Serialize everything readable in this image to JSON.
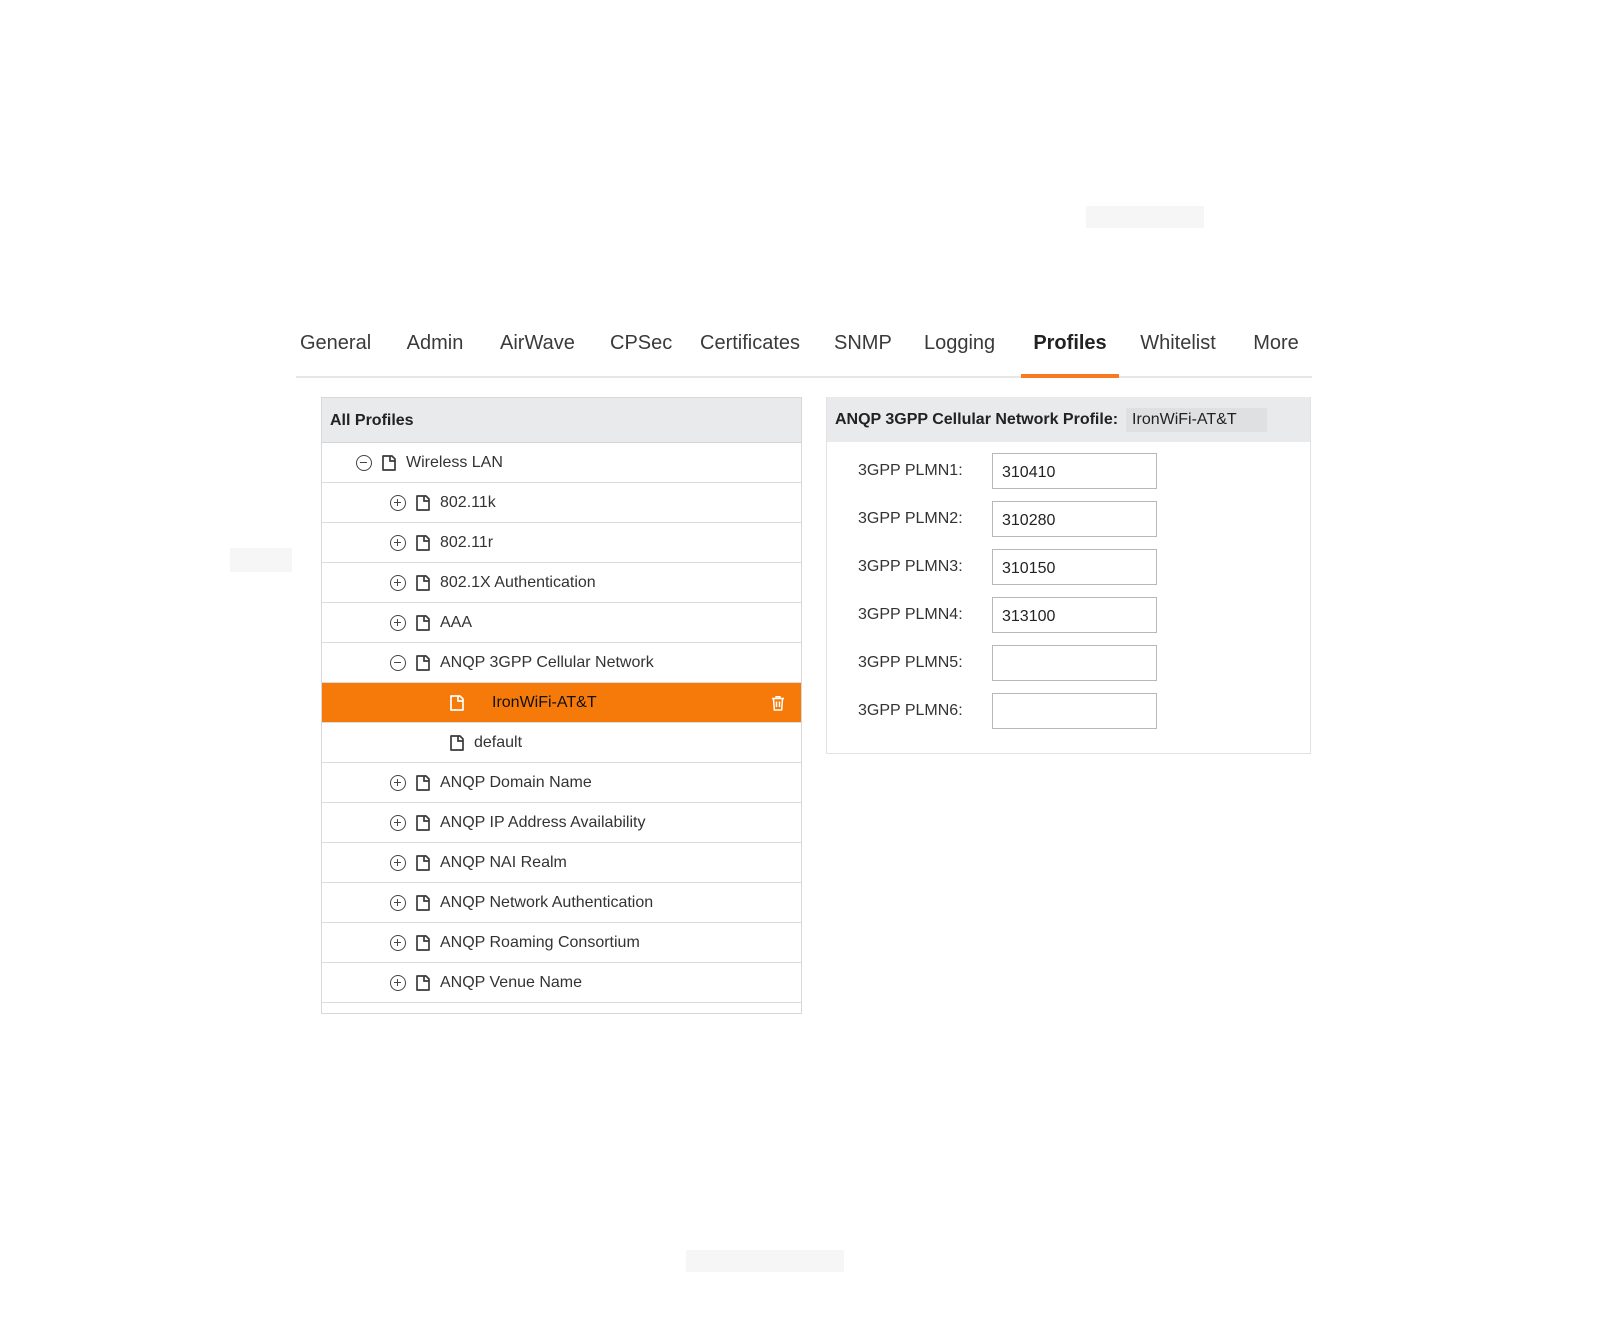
{
  "tabs": [
    {
      "label": "General",
      "active": false
    },
    {
      "label": "Admin",
      "active": false
    },
    {
      "label": "AirWave",
      "active": false
    },
    {
      "label": "CPSec",
      "active": false
    },
    {
      "label": "Certificates",
      "active": false
    },
    {
      "label": "SNMP",
      "active": false
    },
    {
      "label": "Logging",
      "active": false
    },
    {
      "label": "Profiles",
      "active": true
    },
    {
      "label": "Whitelist",
      "active": false
    },
    {
      "label": "More",
      "active": false
    }
  ],
  "left_panel": {
    "title": "All Profiles",
    "tree": [
      {
        "label": "Wireless LAN",
        "toggle": "minus",
        "icon": "document-icon"
      },
      {
        "label": "802.11k",
        "toggle": "plus",
        "icon": "document-icon"
      },
      {
        "label": "802.11r",
        "toggle": "plus",
        "icon": "document-icon"
      },
      {
        "label": "802.1X Authentication",
        "toggle": "plus",
        "icon": "document-icon"
      },
      {
        "label": "AAA",
        "toggle": "plus",
        "icon": "document-icon"
      },
      {
        "label": "ANQP 3GPP Cellular Network",
        "toggle": "minus",
        "icon": "document-icon"
      },
      {
        "label": "IronWiFi-AT&T",
        "toggle": "none",
        "icon": "document-icon",
        "selected": true,
        "action_icon": "trash-icon"
      },
      {
        "label": "default",
        "toggle": "none",
        "icon": "document-icon"
      },
      {
        "label": "ANQP Domain Name",
        "toggle": "plus",
        "icon": "document-icon"
      },
      {
        "label": "ANQP IP Address Availability",
        "toggle": "plus",
        "icon": "document-icon"
      },
      {
        "label": "ANQP NAI Realm",
        "toggle": "plus",
        "icon": "document-icon"
      },
      {
        "label": "ANQP Network Authentication",
        "toggle": "plus",
        "icon": "document-icon"
      },
      {
        "label": "ANQP Roaming Consortium",
        "toggle": "plus",
        "icon": "document-icon"
      },
      {
        "label": "ANQP Venue Name",
        "toggle": "plus",
        "icon": "document-icon"
      }
    ]
  },
  "right_panel": {
    "title": "ANQP 3GPP Cellular Network Profile:",
    "profile_name": "IronWiFi-AT&T",
    "fields": [
      {
        "label": "3GPP PLMN1:",
        "value": "310410"
      },
      {
        "label": "3GPP PLMN2:",
        "value": "310280"
      },
      {
        "label": "3GPP PLMN3:",
        "value": "310150"
      },
      {
        "label": "3GPP PLMN4:",
        "value": "313100"
      },
      {
        "label": "3GPP PLMN5:",
        "value": ""
      },
      {
        "label": "3GPP PLMN6:",
        "value": ""
      }
    ]
  },
  "colors": {
    "accent": "#f57a0a",
    "header_bg": "#e9eaec",
    "border": "#dcdcdc"
  }
}
